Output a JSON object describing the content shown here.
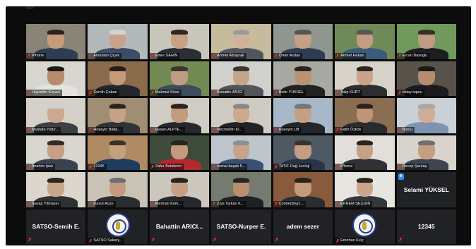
{
  "participants": [
    {
      "label": "iPhone",
      "mic_muted": true,
      "wall": "#8a8478",
      "skin": "#c49c7c",
      "shirt": "#2e3d52",
      "hair": "#2a231f"
    },
    {
      "label": "Abdullah Çiçek",
      "mic_muted": true,
      "wall": "#b3b8ba",
      "skin": "#caa28a",
      "shirt": "#3b4d67",
      "hair": "#d3d3d3"
    },
    {
      "label": "Emre SAHIN",
      "mic_muted": true,
      "wall": "#c8c5bb",
      "skin": "#c8a184",
      "shirt": "#2a2e35",
      "hair": "#302621"
    },
    {
      "label": "Ahmet Albayrak",
      "mic_muted": true,
      "wall": "#c7bb9e",
      "skin": "#d2b19a",
      "shirt": "#51565e",
      "hair": "#9b9b9b"
    },
    {
      "label": "Ömer Arslan",
      "mic_muted": true,
      "wall": "#8f968f",
      "skin": "#c4a088",
      "shirt": "#2d3b53",
      "hair": "#5a5550"
    },
    {
      "label": "Ahmet Hakan",
      "mic_muted": true,
      "wall": "#6f8a58",
      "skin": "#c59b82",
      "shirt": "#3c5a7a",
      "hair": "#555"
    },
    {
      "label": "Ercan Basoglu",
      "mic_muted": true,
      "wall": "#6f9a5c",
      "skin": "#c09a82",
      "shirt": "#1d1d22",
      "hair": "#3a2d26"
    },
    {
      "label": "Hayrettin Koyacı",
      "mic_muted": true,
      "wall": "#d8d6d0",
      "skin": "#b58b6c",
      "shirt": "#e5e3df",
      "hair": "#1d1915"
    },
    {
      "label": "Semih Çoban",
      "mic_muted": true,
      "wall": "#8a6b4c",
      "skin": "#c49a79",
      "shirt": "#24262c",
      "hair": "#231d19"
    },
    {
      "label": "Mahmut Köse",
      "mic_muted": true,
      "wall": "#738a55",
      "skin": "#c09c84",
      "shirt": "#3f4b5c",
      "hair": "#3d3530"
    },
    {
      "label": "Bahattin ARICI",
      "mic_muted": true,
      "wall": "#d0d0cc",
      "skin": "#c7a587",
      "shirt": "#52545a",
      "hair": "#3d3631"
    },
    {
      "label": "Bekir YÜKSEL",
      "mic_muted": true,
      "wall": "#a7a9a2",
      "skin": "#b99474",
      "shirt": "#222",
      "hair": "#2a2420"
    },
    {
      "label": "Talip KURT",
      "mic_muted": true,
      "wall": "#d6d2ca",
      "skin": "#c9a486",
      "shirt": "#2c2d30",
      "hair": "#2b2520"
    },
    {
      "label": "oktay topcu",
      "mic_muted": true,
      "wall": "#57534b",
      "skin": "#b68c6e",
      "shirt": "#1a1b1f",
      "hair": "#1b1816"
    },
    {
      "label": "Mustafa Yıldır...",
      "mic_muted": true,
      "wall": "#d5d1c8",
      "skin": "#cba88f",
      "shirt": "#3b3f46",
      "hair": "#cfcfcf"
    },
    {
      "label": "Hüseyin Balta...",
      "mic_muted": true,
      "wall": "#a08e73",
      "skin": "#c8a286",
      "shirt": "#2f3239",
      "hair": "#2b2522"
    },
    {
      "label": "Hasan ALPTE...",
      "mic_muted": true,
      "wall": "#d0ccc3",
      "skin": "#c29c7c",
      "shirt": "#25272c",
      "hair": "#2a2520"
    },
    {
      "label": "Necmettin Kl...",
      "mic_muted": true,
      "wall": "#cfcbc2",
      "skin": "#cca88d",
      "shirt": "#202226",
      "hair": "#888"
    },
    {
      "label": "Hüseyin Lift",
      "mic_muted": true,
      "wall": "#a7b9c8",
      "skin": "#c79f82",
      "shirt": "#24262c",
      "hair": "#777"
    },
    {
      "label": "Fatih Özkök",
      "mic_muted": true,
      "wall": "#8b6d52",
      "skin": "#c09476",
      "shirt": "#2a2b2f",
      "hair": "#2a221d"
    },
    {
      "label": "Burcu",
      "mic_muted": true,
      "wall": "#c9d0d6",
      "skin": "#cfae95",
      "shirt": "#7f94b0",
      "hair": "#a8a8a8"
    },
    {
      "label": "İbrahim İpek",
      "mic_muted": true,
      "wall": "#d9d6cf",
      "skin": "#c6a085",
      "shirt": "#3a4250",
      "hair": "#342c27"
    },
    {
      "label": "12345",
      "mic_muted": true,
      "wall": "#b08a62",
      "skin": "#c3a07e",
      "shirt": "#1f3c5d",
      "hair": "#3a302a"
    },
    {
      "label": "Zafer Bekdemir",
      "mic_muted": true,
      "wall": "#3d4c3a",
      "skin": "#c39a7d",
      "shirt": "#b5282f",
      "hair": "#2a221e"
    },
    {
      "label": "cemal başak 5...",
      "mic_muted": true,
      "wall": "#bcc4cc",
      "skin": "#c8a28a",
      "shirt": "#3a4f72",
      "hair": "#8f8f8f"
    },
    {
      "label": "TATIF Dağ-Jeoloji",
      "mic_muted": true,
      "wall": "#4e5a63",
      "skin": "#c49d84",
      "shirt": "#283448",
      "hair": "#3a322e"
    },
    {
      "label": "iPhone",
      "mic_muted": true,
      "wall": "#e2dfda",
      "skin": "#c6a084",
      "shirt": "#2f3136",
      "hair": "#2a2420"
    },
    {
      "label": "Recep Şarıtaş",
      "mic_muted": true,
      "wall": "#d8d4cb",
      "skin": "#c59f82",
      "shirt": "#3f454f",
      "hair": "#6f6f6f"
    },
    {
      "label": "Savaş Yılmazer",
      "mic_muted": true,
      "wall": "#dcd7ce",
      "skin": "#c9a589",
      "shirt": "#2f3033",
      "hair": "#2b2521"
    },
    {
      "label": "Davut Acun",
      "mic_muted": true,
      "wall": "#c9c3b6",
      "skin": "#c29b7e",
      "shirt": "#2a2c31",
      "hair": "#6f6f6f"
    },
    {
      "label": "Mertcan Kork...",
      "mic_muted": true,
      "wall": "#cbc7bf",
      "skin": "#c6a085",
      "shirt": "#26282c",
      "hair": "#2b241f"
    },
    {
      "label": "Ziya Tarkan K...",
      "mic_muted": true,
      "wall": "#767b70",
      "skin": "#b8906f",
      "shirt": "#1f2024",
      "hair": "#2b2420"
    },
    {
      "label": "Connecting t...",
      "mic_muted": true,
      "wall": "#8a5a3c",
      "skin": "#c59a7a",
      "shirt": "#2b2d33",
      "hair": "#2a221d"
    },
    {
      "label": "EKREM SEÇGİN",
      "mic_muted": true,
      "wall": "#e7e5e0",
      "skin": "#caa58a",
      "shirt": "#34363b",
      "hair": "#2c2622"
    }
  ],
  "name_tiles_row5": [
    {
      "name": "Selami YÜKSEL",
      "has_badge": true,
      "badge": "6"
    }
  ],
  "bottom_row": [
    {
      "kind": "name",
      "name": "SATSO-Semih E."
    },
    {
      "kind": "logo",
      "label": "SATSO Sakary..."
    },
    {
      "kind": "name",
      "name": "Bahattin  ARICI..."
    },
    {
      "kind": "name",
      "name": "SATSO-Nurper E."
    },
    {
      "kind": "name",
      "name": "adem sezer"
    },
    {
      "kind": "logo",
      "label": "Emirhan Kılıç"
    },
    {
      "kind": "name",
      "name": "12345"
    }
  ],
  "colors": {
    "tile_bg": "#202225",
    "mic_muted": "#e03030",
    "badge": "#2d8cff",
    "app_bg": "#0c0c0c"
  }
}
